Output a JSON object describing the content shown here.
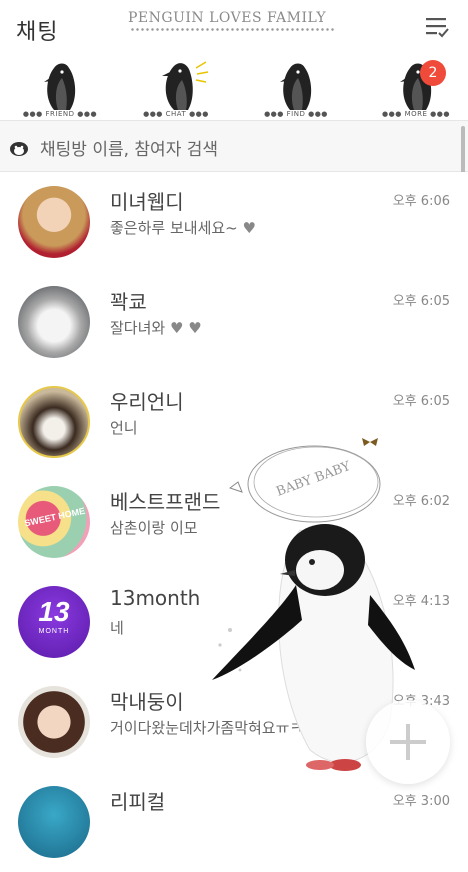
{
  "header": {
    "title": "채팅",
    "banner": "PENGUIN LOVES FAMILY",
    "menu_icon": "list-check-icon"
  },
  "tabs": [
    {
      "label": "FRIEND",
      "icon": "penguin-icon"
    },
    {
      "label": "CHAT",
      "icon": "penguin-icon"
    },
    {
      "label": "FIND",
      "icon": "penguin-icon"
    },
    {
      "label": "MORE",
      "icon": "penguin-icon",
      "badge": "2"
    }
  ],
  "search": {
    "placeholder": "채팅방 이름, 참여자 검색"
  },
  "chats": [
    {
      "name": "미녀웹디",
      "message": "좋은하루 보내세요~",
      "hearts": "♥",
      "time": "오후 6:06",
      "avatar": "woman-blonde-avatar"
    },
    {
      "name": "꽉쿄",
      "message": "잘다녀와",
      "hearts": "♥ ♥",
      "time": "오후 6:05",
      "avatar": "kitten-avatar"
    },
    {
      "name": "우리언니",
      "message": "언니",
      "hearts": "",
      "time": "오후 6:05",
      "avatar": "dog-bunny-ears-avatar"
    },
    {
      "name": "베스트프랜드",
      "message": "삼촌이랑 이모",
      "hearts": "",
      "time": "오후 6:02",
      "avatar": "sweet-home-candy-avatar"
    },
    {
      "name": "13month",
      "message": "네",
      "hearts": "",
      "time": "오후 4:13",
      "avatar": "13month-logo-avatar",
      "avatar_text": "13",
      "avatar_sub": "MONTH"
    },
    {
      "name": "막내둥이",
      "message": "거이다왔눈데차가좀막혀요ㅠㅋㅋㅋㅋㅋ",
      "hearts": "",
      "time": "오후 3:43",
      "avatar": "woman-portrait-avatar"
    },
    {
      "name": "리피컬",
      "message": "",
      "hearts": "",
      "time": "오후 3:00",
      "avatar": "partial-avatar"
    }
  ],
  "decor": {
    "baby_text": "BABY BABY"
  },
  "fab": {
    "icon": "plus-icon"
  },
  "colors": {
    "badge": "#f04a3a",
    "penguin": "#222222"
  }
}
